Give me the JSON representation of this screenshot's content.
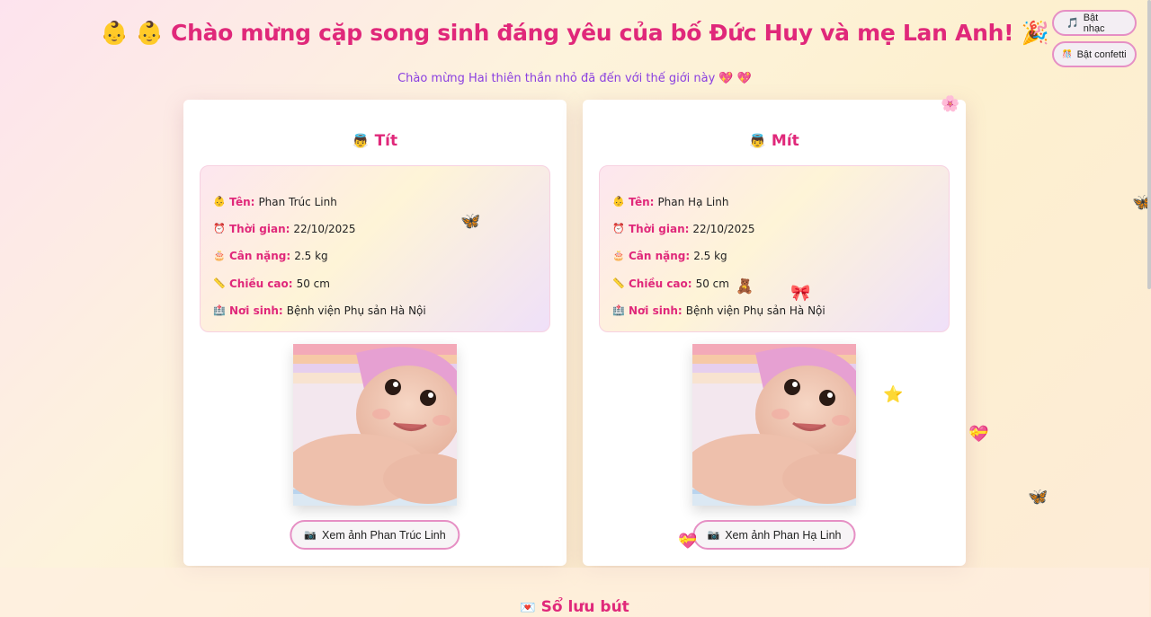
{
  "header": {
    "title": "👶 👶 Chào mừng cặp song sinh đáng yêu của bố Đức Huy và mẹ Lan Anh! 🎉",
    "subtitle": "Chào mừng Hai thiên thần nhỏ đã đến với thế giới này 💖 💖"
  },
  "controls": {
    "music_icon": "🎵",
    "music_label": "Bật nhạc",
    "confetti_icon": "🎊",
    "confetti_label": "Bật confetti"
  },
  "labels": {
    "name": "Tên:",
    "time": "Thời gian:",
    "weight": "Cân nặng:",
    "height": "Chiều cao:",
    "birthplace": "Nơi sinh:"
  },
  "icons": {
    "baby": "👼",
    "name": "👶",
    "time": "⏰",
    "weight": "🎂",
    "height": "📏",
    "birthplace": "🏥",
    "camera": "📷",
    "guestbook": "💌"
  },
  "babies": [
    {
      "nickname": "Tít",
      "name": "Phan Trúc Linh",
      "time": "22/10/2025",
      "weight": "2.5 kg",
      "height": "50 cm",
      "birthplace": "Bệnh viện Phụ sản Hà Nội",
      "button": "Xem ảnh Phan Trúc Linh"
    },
    {
      "nickname": "Mít",
      "name": "Phan Hạ Linh",
      "time": "22/10/2025",
      "weight": "2.5 kg",
      "height": "50 cm",
      "birthplace": "Bệnh viện Phụ sản Hà Nội",
      "button": "Xem ảnh Phan Hạ Linh"
    }
  ],
  "guestbook": {
    "title": "Sổ lưu bút"
  },
  "decorations": [
    "🌸",
    "🦋",
    "💝",
    "⭐",
    "🧸",
    "🎀"
  ]
}
